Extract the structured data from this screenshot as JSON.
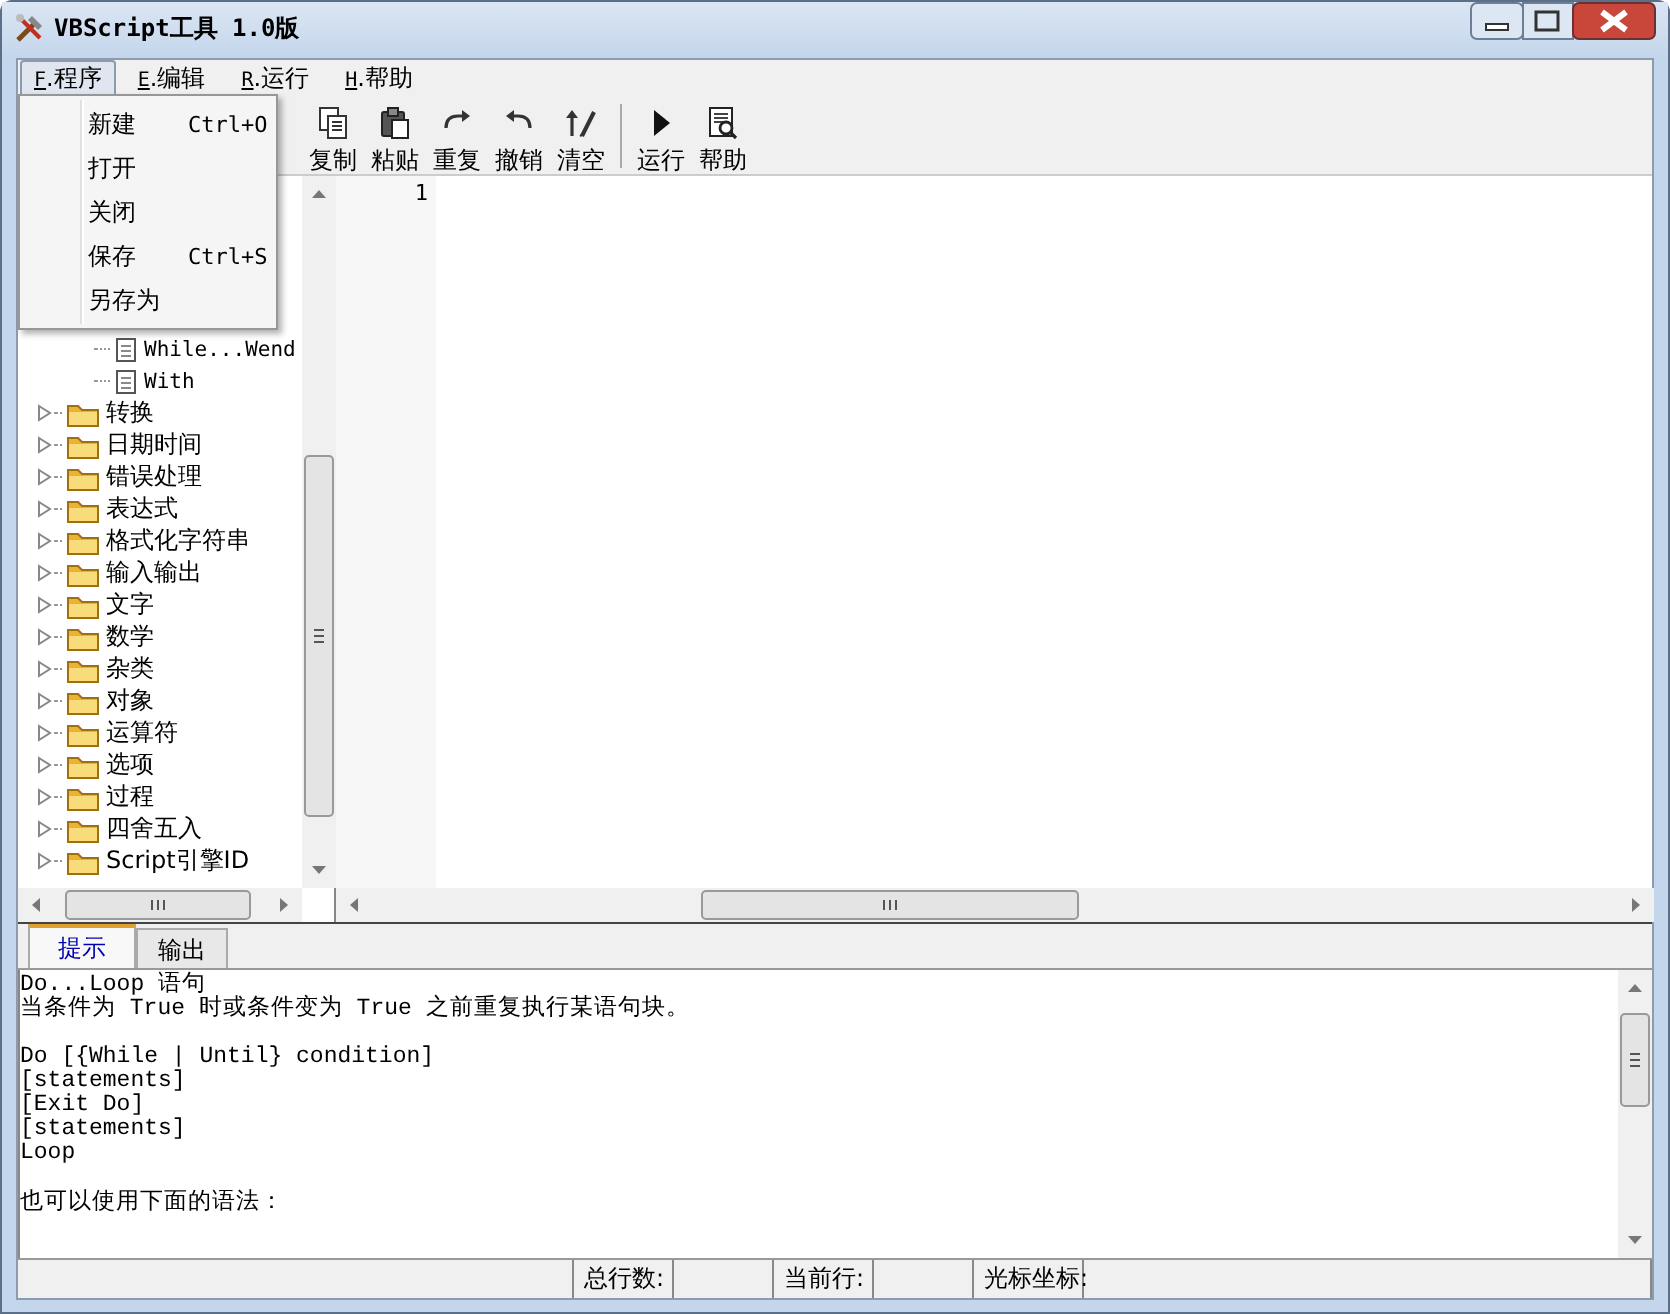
{
  "window": {
    "title": "VBScript工具 1.0版"
  },
  "menu_bar": [
    {
      "key": "F",
      "label": ".程序",
      "selected": true
    },
    {
      "key": "E",
      "label": ".编辑",
      "selected": false
    },
    {
      "key": "R",
      "label": ".运行",
      "selected": false
    },
    {
      "key": "H",
      "label": ".帮助",
      "selected": false
    }
  ],
  "open_menu": {
    "items": [
      {
        "label": "新建",
        "shortcut": "Ctrl+O"
      },
      {
        "label": "打开"
      },
      {
        "label": "关闭"
      },
      {
        "label": "保存",
        "shortcut": "Ctrl+S"
      },
      {
        "label": "另存为"
      }
    ]
  },
  "toolbar": {
    "buttons": [
      {
        "label": "复制",
        "kind": "copy"
      },
      {
        "label": "粘贴",
        "kind": "paste"
      },
      {
        "label": "重复",
        "kind": "redo"
      },
      {
        "label": "撤销",
        "kind": "undo"
      },
      {
        "label": "清空",
        "kind": "clear"
      },
      {
        "kind": "separator"
      },
      {
        "label": "运行",
        "kind": "run"
      },
      {
        "label": "帮助",
        "kind": "help"
      }
    ]
  },
  "tree": {
    "items": [
      {
        "label": "While...Wend",
        "kind": "leaf"
      },
      {
        "label": "With",
        "kind": "leaf"
      },
      {
        "label": "转换",
        "kind": "folder",
        "expanded": false
      },
      {
        "label": "日期时间",
        "kind": "folder",
        "expanded": false
      },
      {
        "label": "错误处理",
        "kind": "folder",
        "expanded": false
      },
      {
        "label": "表达式",
        "kind": "folder",
        "expanded": false
      },
      {
        "label": "格式化字符串",
        "kind": "folder",
        "expanded": false
      },
      {
        "label": "输入输出",
        "kind": "folder",
        "expanded": false
      },
      {
        "label": "文字",
        "kind": "folder",
        "expanded": false
      },
      {
        "label": "数学",
        "kind": "folder",
        "expanded": false
      },
      {
        "label": "杂类",
        "kind": "folder",
        "expanded": false
      },
      {
        "label": "对象",
        "kind": "folder",
        "expanded": false
      },
      {
        "label": "运算符",
        "kind": "folder",
        "expanded": false
      },
      {
        "label": "选项",
        "kind": "folder",
        "expanded": false
      },
      {
        "label": "过程",
        "kind": "folder",
        "expanded": false
      },
      {
        "label": "四舍五入",
        "kind": "folder",
        "expanded": false
      },
      {
        "label": "Script引擎ID",
        "kind": "folder",
        "expanded": false
      }
    ]
  },
  "editor": {
    "line_numbers": [
      "1"
    ]
  },
  "bottom_tabs": [
    {
      "label": "提示",
      "selected": true
    },
    {
      "label": "输出",
      "selected": false
    }
  ],
  "hint_text": {
    "paragraphs": [
      [
        "Do...Loop 语句",
        "当条件为 True 时或条件变为 True 之前重复执行某语句块。"
      ],
      [
        "Do [{While | Until} condition]",
        "[statements]",
        "[Exit Do]",
        "[statements]",
        "Loop"
      ],
      [
        "也可以使用下面的语法："
      ]
    ]
  },
  "status_bar": {
    "fields": [
      "总行数:",
      "当前行:",
      "光标坐标:"
    ]
  }
}
